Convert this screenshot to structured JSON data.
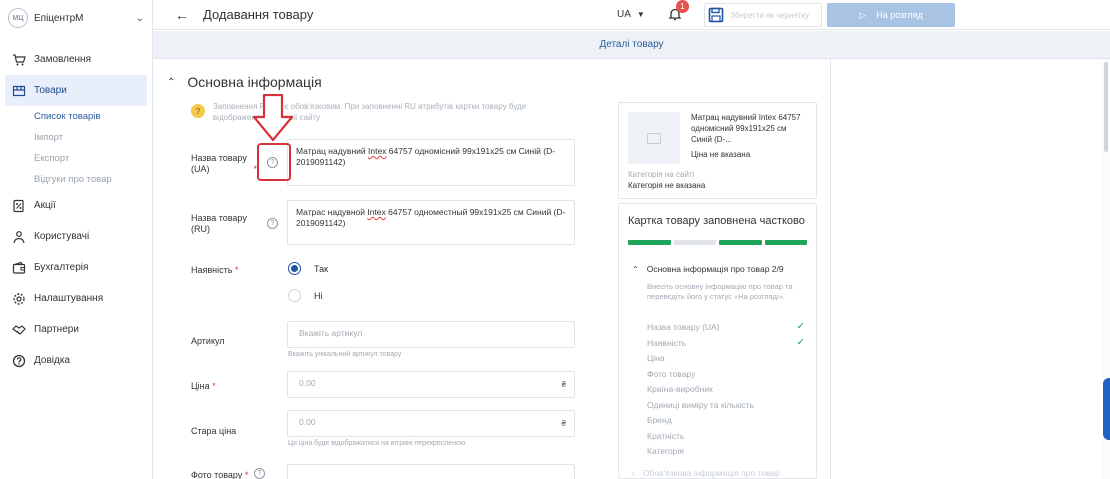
{
  "sidebar": {
    "brand_logo": "МЦ",
    "brand_name": "ЕпіцентрМ",
    "items": [
      {
        "label": "Замовлення",
        "icon": "cart-icon"
      },
      {
        "label": "Товари",
        "icon": "box-icon",
        "active": true
      },
      {
        "label": "Акції",
        "icon": "percent-icon"
      },
      {
        "label": "Користувачі",
        "icon": "users-icon"
      },
      {
        "label": "Бухгалтерія",
        "icon": "wallet-icon"
      },
      {
        "label": "Налаштування",
        "icon": "gear-icon"
      },
      {
        "label": "Партнери",
        "icon": "handshake-icon"
      },
      {
        "label": "Довідка",
        "icon": "help-circle-icon"
      }
    ],
    "sub_items": [
      {
        "label": "Список товарів",
        "active": true
      },
      {
        "label": "Імпорт"
      },
      {
        "label": "Експорт"
      },
      {
        "label": "Відгуки про товар"
      }
    ]
  },
  "topbar": {
    "title": "Додавання товару",
    "lang": "UA",
    "notifications": "1",
    "draft_label": "Зберегти як чернетку",
    "review_label": "На розгляд"
  },
  "tabbar": {
    "label": "Деталі товару"
  },
  "section": {
    "title": "Основна інформація",
    "note": "Заповнення RU не є обов'язковим. При заповненні RU атрибутів картки товару буде відображено RU версії сайту"
  },
  "form": {
    "name_ua": {
      "label": "Назва товару (UA)",
      "value_pre": "Матрац надувний ",
      "value_mark": "Intex",
      "value_post": " 64757 одномісний 99х191х25 см Синій (D-2019091142)"
    },
    "name_ru": {
      "label": "Назва товару (RU)",
      "value_pre": "Матрас надувной ",
      "value_mark": "Intex",
      "value_post": " 64757 одноместный 99х191х25 см Синий (D-2019091142)"
    },
    "availability": {
      "label": "Наявність",
      "options": [
        "Так",
        "Ні"
      ],
      "selected": "Так"
    },
    "sku": {
      "label": "Артикул",
      "placeholder": "Вкажіть артикул",
      "hint": "Вкажіть унікальний артикул товару"
    },
    "price": {
      "label": "Ціна",
      "value": "0.00",
      "currency": "₴"
    },
    "old_price": {
      "label": "Стара ціна",
      "value": "0.00",
      "currency": "₴",
      "hint": "Ця ціна буде відображатися на вітрині перекресленою"
    },
    "photo": {
      "label": "Фото товару"
    }
  },
  "preview": {
    "name": "Матрац надувний Intex 64757 одномісний 99х191х25 см Синій (D-...",
    "price": "Ціна не вказана",
    "category_label": "Категорія на сайті",
    "category": "Категорія не вказана"
  },
  "progress": {
    "title": "Картка товару заповнена частково",
    "segments": [
      true,
      false,
      true,
      true
    ],
    "group_title": "Основна інформація про товар 2/9",
    "group_desc": "Внесіть основну інформацію про товар та перевєдіть його у статус «На розгляді».",
    "checklist": [
      {
        "label": "Назва товару (UA)",
        "done": true
      },
      {
        "label": "Наявність",
        "done": true
      },
      {
        "label": "Ціна",
        "done": false
      },
      {
        "label": "Фото товару",
        "done": false
      },
      {
        "label": "Країна-виробник",
        "done": false
      },
      {
        "label": "Одиниці виміру та кількість",
        "done": false
      },
      {
        "label": "Бренд",
        "done": false
      },
      {
        "label": "Кратність",
        "done": false
      },
      {
        "label": "Категорія",
        "done": false
      }
    ],
    "group2_title": "Обов'язкова інформація про товар"
  },
  "colors": {
    "accent": "#1f55a5",
    "success": "#1ea35a",
    "annotation": "#d6313a"
  }
}
